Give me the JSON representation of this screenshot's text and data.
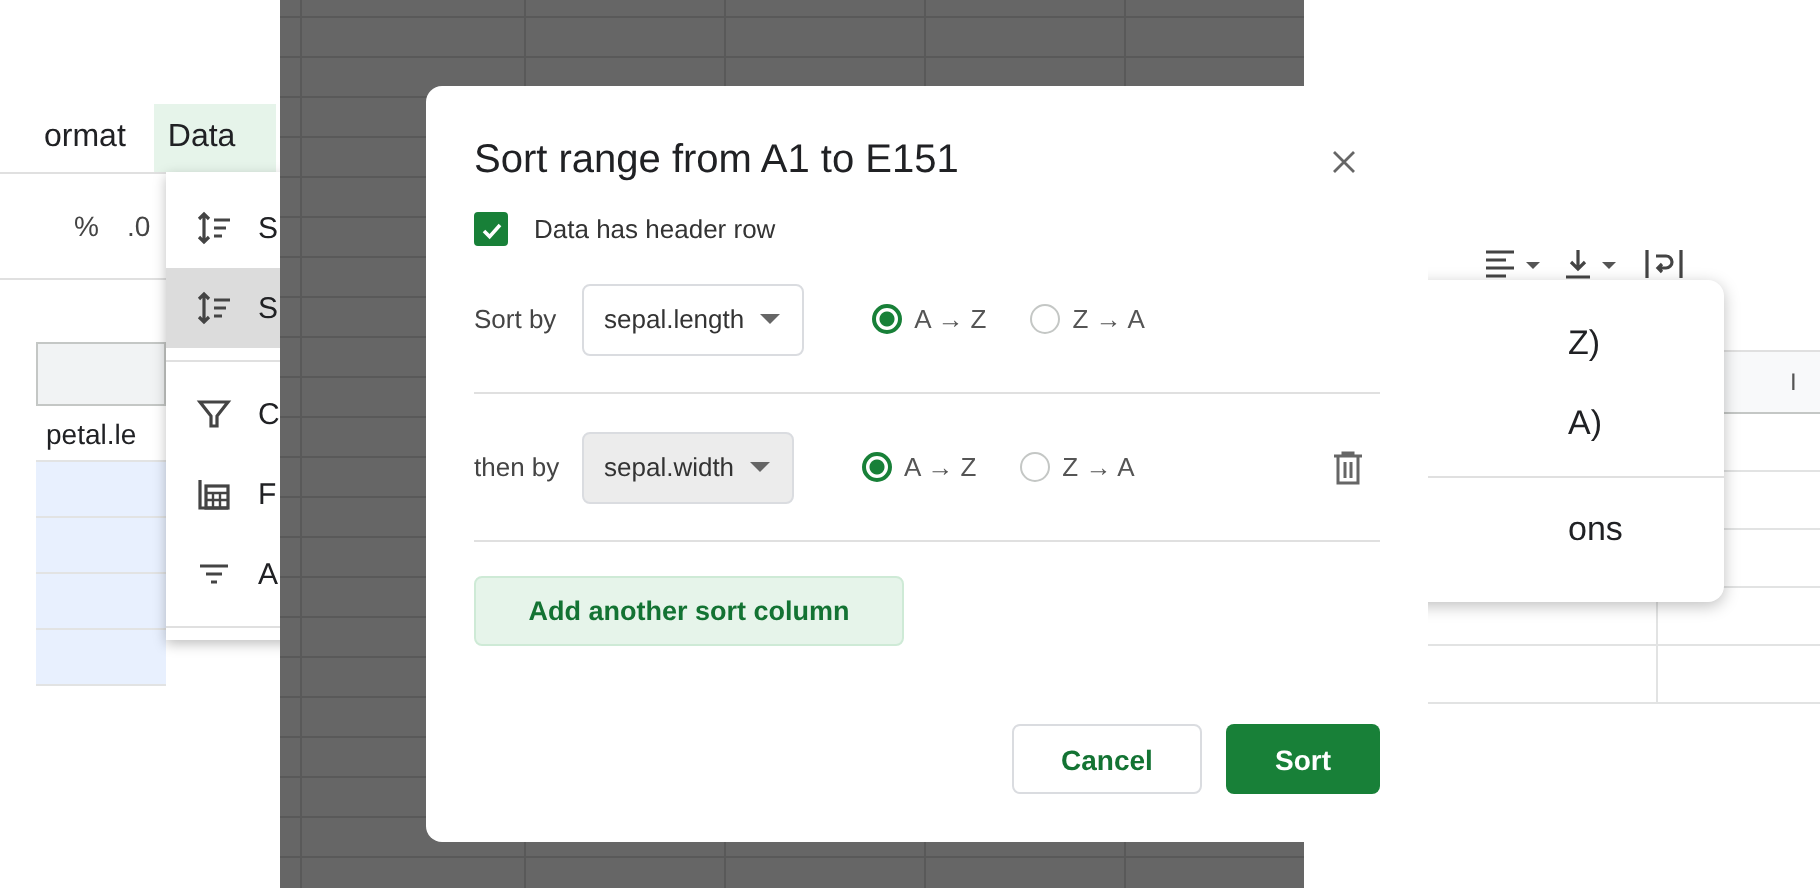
{
  "menu_bar": [
    {
      "label": "ormat",
      "selected": false
    },
    {
      "label": "Data",
      "selected": true
    }
  ],
  "toolbar_left": [
    "%",
    ".0"
  ],
  "data_menu": {
    "sections": [
      [
        {
          "label": "S",
          "kind": "sort",
          "highlighted": false
        },
        {
          "label": "S",
          "kind": "sort",
          "highlighted": true
        }
      ],
      [
        {
          "label": "C",
          "kind": "filter",
          "highlighted": false
        },
        {
          "label": "F",
          "kind": "filter-views",
          "highlighted": false
        },
        {
          "label": "A",
          "kind": "slicer",
          "highlighted": false
        }
      ]
    ]
  },
  "sheet_left": {
    "cells": [
      "petal.le"
    ]
  },
  "dialog": {
    "title": "Sort range from A1 to E151",
    "header_row": {
      "label": "Data has header row",
      "checked": true
    },
    "sort_rows": [
      {
        "label": "Sort by",
        "column": "sepal.length",
        "focused": false,
        "deletable": false,
        "options": [
          {
            "label": "A → Z",
            "selected": true
          },
          {
            "label": "Z → A",
            "selected": false
          }
        ]
      },
      {
        "label": "then by",
        "column": "sepal.width",
        "focused": true,
        "deletable": true,
        "options": [
          {
            "label": "A → Z",
            "selected": true
          },
          {
            "label": "Z → A",
            "selected": false
          }
        ]
      }
    ],
    "add_button": "Add another sort column",
    "buttons": [
      {
        "label": "Cancel",
        "kind": "secondary"
      },
      {
        "label": "Sort",
        "kind": "primary"
      }
    ]
  },
  "sort_menu": {
    "sections": [
      [
        "Z)",
        "A)"
      ],
      [
        "ons"
      ]
    ]
  },
  "sheet_right": {
    "column_header": "I"
  }
}
